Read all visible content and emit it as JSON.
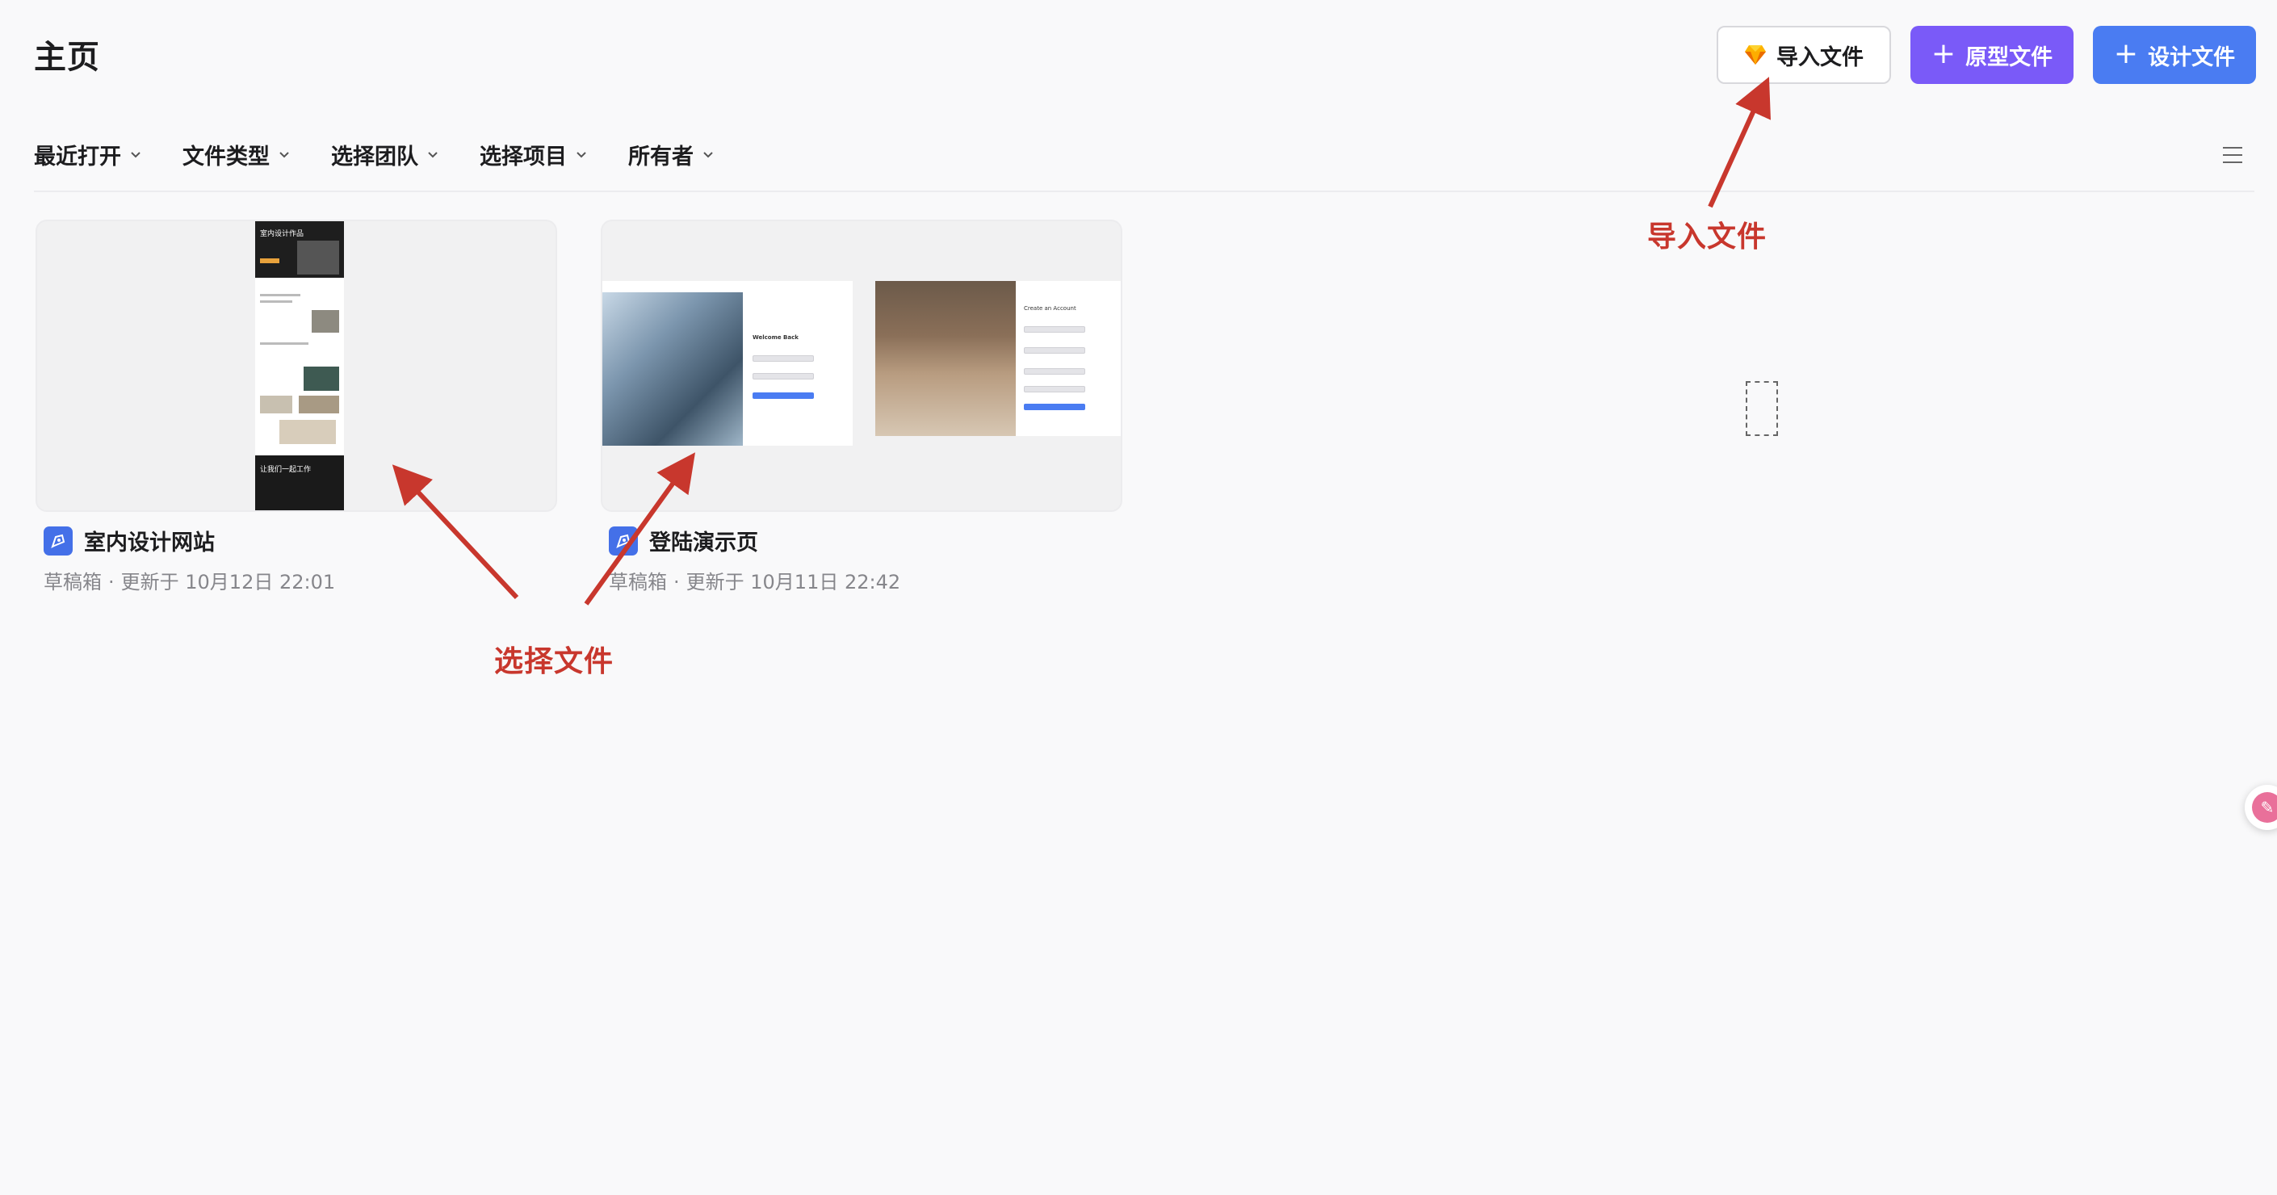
{
  "header": {
    "title": "主页",
    "import_button": "导入文件",
    "prototype_button": "原型文件",
    "design_button": "设计文件"
  },
  "filters": [
    "最近打开",
    "文件类型",
    "选择团队",
    "选择项目",
    "所有者"
  ],
  "files": [
    {
      "name": "室内设计网站",
      "location": "草稿箱",
      "updated": "更新于 10月12日 22:01"
    },
    {
      "name": "登陆演示页",
      "location": "草稿箱",
      "updated": "更新于 10月11日 22:42"
    }
  ],
  "annotations": {
    "select_file": "选择文件",
    "import_file": "导入文件"
  },
  "thumbnail_text": {
    "interior_hero": "室内设计作品",
    "interior_footer": "让我们一起工作",
    "login_welcome": "Welcome Back",
    "login_create": "Create an Account"
  },
  "colors": {
    "prototype_button": "#7a5af8",
    "design_button": "#4a7cf2",
    "annotation": "#c8372d",
    "file_icon": "#4470e8"
  },
  "icons": {
    "import": "sketch-diamond-icon",
    "view_toggle": "list-view-icon",
    "file": "design-file-icon"
  }
}
